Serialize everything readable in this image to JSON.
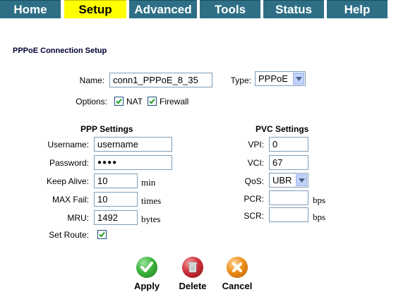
{
  "nav": {
    "tabs": [
      {
        "label": "Home",
        "active": false
      },
      {
        "label": "Setup",
        "active": true
      },
      {
        "label": "Advanced",
        "active": false
      },
      {
        "label": "Tools",
        "active": false
      },
      {
        "label": "Status",
        "active": false
      },
      {
        "label": "Help",
        "active": false
      }
    ]
  },
  "page": {
    "section_title": "PPPoE Connection Setup"
  },
  "connection": {
    "name_label": "Name:",
    "name_value": "conn1_PPPoE_8_35",
    "type_label": "Type:",
    "type_value": "PPPoE",
    "options_label": "Options:",
    "nat_label": "NAT",
    "nat_checked": true,
    "firewall_label": "Firewall",
    "firewall_checked": true
  },
  "ppp": {
    "header": "PPP Settings",
    "username_label": "Username:",
    "username_value": "username",
    "password_label": "Password:",
    "password_value": "●●●●",
    "keepalive_label": "Keep Alive:",
    "keepalive_value": "10",
    "keepalive_unit": "min",
    "maxfail_label": "MAX Fail:",
    "maxfail_value": "10",
    "maxfail_unit": "times",
    "mru_label": "MRU:",
    "mru_value": "1492",
    "mru_unit": "bytes",
    "setroute_label": "Set Route:",
    "setroute_checked": true
  },
  "pvc": {
    "header": "PVC Settings",
    "vpi_label": "VPI:",
    "vpi_value": "0",
    "vci_label": "VCI:",
    "vci_value": "67",
    "qos_label": "QoS:",
    "qos_value": "UBR",
    "pcr_label": "PCR:",
    "pcr_value": "",
    "pcr_unit": "bps",
    "scr_label": "SCR:",
    "scr_value": "",
    "scr_unit": "bps"
  },
  "actions": {
    "apply_label": "Apply",
    "delete_label": "Delete",
    "cancel_label": "Cancel"
  },
  "colors": {
    "tab_bg": "#2e6f86",
    "tab_active_bg": "#ffff00",
    "apply": "#2e9d2e",
    "delete": "#b8202a",
    "cancel": "#e07a10"
  }
}
